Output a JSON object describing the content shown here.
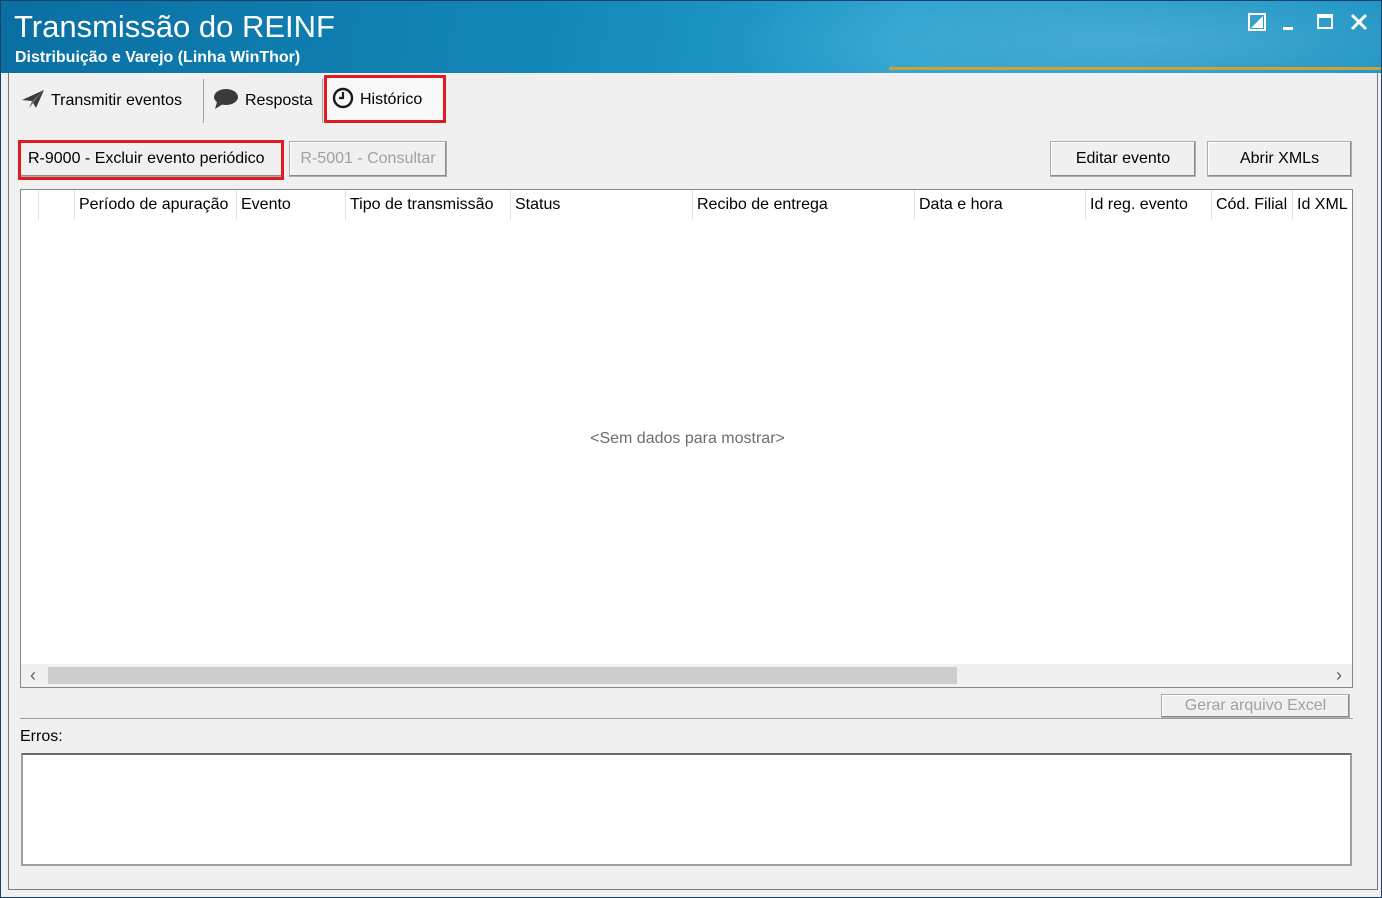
{
  "window": {
    "title": "Transmissão do REINF",
    "subtitle": "Distribuição e Varejo (Linha WinThor)",
    "controls": {
      "restore_icon": "restore-icon",
      "minimize_icon": "minimize-icon",
      "maximize_icon": "maximize-icon",
      "close_icon": "close-icon"
    }
  },
  "tabs": [
    {
      "label": "Transmitir eventos",
      "icon": "paper-plane-icon",
      "active": false
    },
    {
      "label": "Resposta",
      "icon": "speech-bubble-icon",
      "active": false
    },
    {
      "label": "Histórico",
      "icon": "clock-icon",
      "active": true
    }
  ],
  "toolbar": {
    "excluir_label": "R-9000 - Excluir evento periódico",
    "consultar_label": "R-5001 - Consultar",
    "editar_label": "Editar evento",
    "abrir_label": "Abrir XMLs"
  },
  "grid": {
    "columns": [
      "Período de apuração",
      "Evento",
      "Tipo de transmissão",
      "Status",
      "Recibo de entrega",
      "Data e hora",
      "Id reg. evento",
      "Cód. Filial",
      "Id XML"
    ],
    "empty_text": "<Sem dados para mostrar>"
  },
  "footer": {
    "excel_label": "Gerar arquivo Excel",
    "errors_label": "Erros:"
  },
  "colors": {
    "titlebar": "#1387b8",
    "highlight": "#e01b24"
  }
}
